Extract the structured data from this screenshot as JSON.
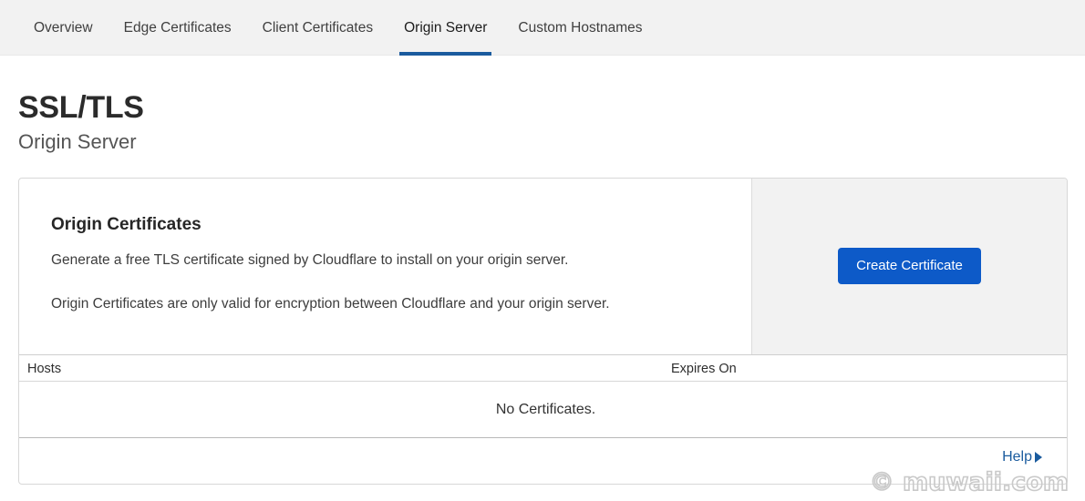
{
  "navbar": {
    "tabs": [
      {
        "label": "Overview",
        "active": false
      },
      {
        "label": "Edge Certificates",
        "active": false
      },
      {
        "label": "Client Certificates",
        "active": false
      },
      {
        "label": "Origin Server",
        "active": true
      },
      {
        "label": "Custom Hostnames",
        "active": false
      }
    ]
  },
  "page": {
    "title": "SSL/TLS",
    "subtitle": "Origin Server"
  },
  "card": {
    "heading": "Origin Certificates",
    "description_line_1": "Generate a free TLS certificate signed by Cloudflare to install on your origin server.",
    "description_line_2": "Origin Certificates are only valid for encryption between Cloudflare and your origin server.",
    "create_button_label": "Create Certificate",
    "table": {
      "columns": [
        "Hosts",
        "Expires On"
      ],
      "rows": [],
      "empty_message": "No Certificates."
    },
    "footer": {
      "help_label": "Help",
      "help_arrow_icon": "triangle-right-icon"
    }
  },
  "watermark": {
    "text": "© muwaii.com"
  },
  "colors": {
    "accent_blue": "#0d5ac8",
    "tab_underline": "#1a5b9e",
    "navbar_bg": "#f2f2f2",
    "panel_bg": "#f2f2f2",
    "card_border": "#d8d8d8"
  }
}
